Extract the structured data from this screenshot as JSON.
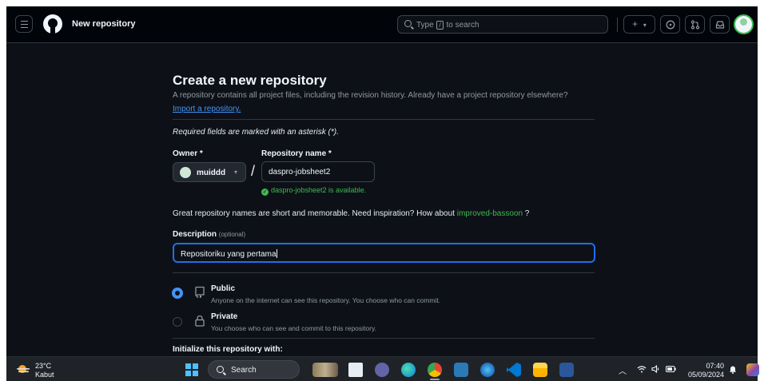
{
  "header": {
    "page_title": "New repository",
    "search": {
      "before": "Type",
      "key": "/",
      "after": "to search"
    },
    "plus_label": "+",
    "caret": "▾"
  },
  "form": {
    "title": "Create a new repository",
    "lead": "A repository contains all project files, including the revision history. Already have a project repository elsewhere?",
    "import_link": "Import a repository.",
    "required_note": "Required fields are marked with an asterisk (*).",
    "owner_label": "Owner *",
    "owner_value": "muiddd",
    "separator": "/",
    "repo_label": "Repository name *",
    "repo_value": "daspro-jobsheet2",
    "availability": "daspro-jobsheet2 is available.",
    "suggestion_prefix": "Great repository names are short and memorable. Need inspiration? How about",
    "suggestion": "improved-bassoon",
    "suggestion_suffix": "?",
    "description_label": "Description",
    "description_optional": "(optional)",
    "description_value": "Repositoriku yang pertama",
    "visibility": [
      {
        "title": "Public",
        "desc": "Anyone on the internet can see this repository. You choose who can commit.",
        "selected": true
      },
      {
        "title": "Private",
        "desc": "You choose who can see and commit to this repository.",
        "selected": false
      }
    ],
    "initialize_label": "Initialize this repository with:"
  },
  "taskbar": {
    "weather_temp": "23°C",
    "weather_condition": "Kabut",
    "search_label": "Search",
    "time": "07:40",
    "date": "05/09/2024"
  },
  "colors": {
    "bg": "#0d1117",
    "header_bg": "#010409",
    "border": "#30363d",
    "accent_blue": "#4493f8",
    "success_green": "#3fb950",
    "muted_text": "#9198a1"
  }
}
